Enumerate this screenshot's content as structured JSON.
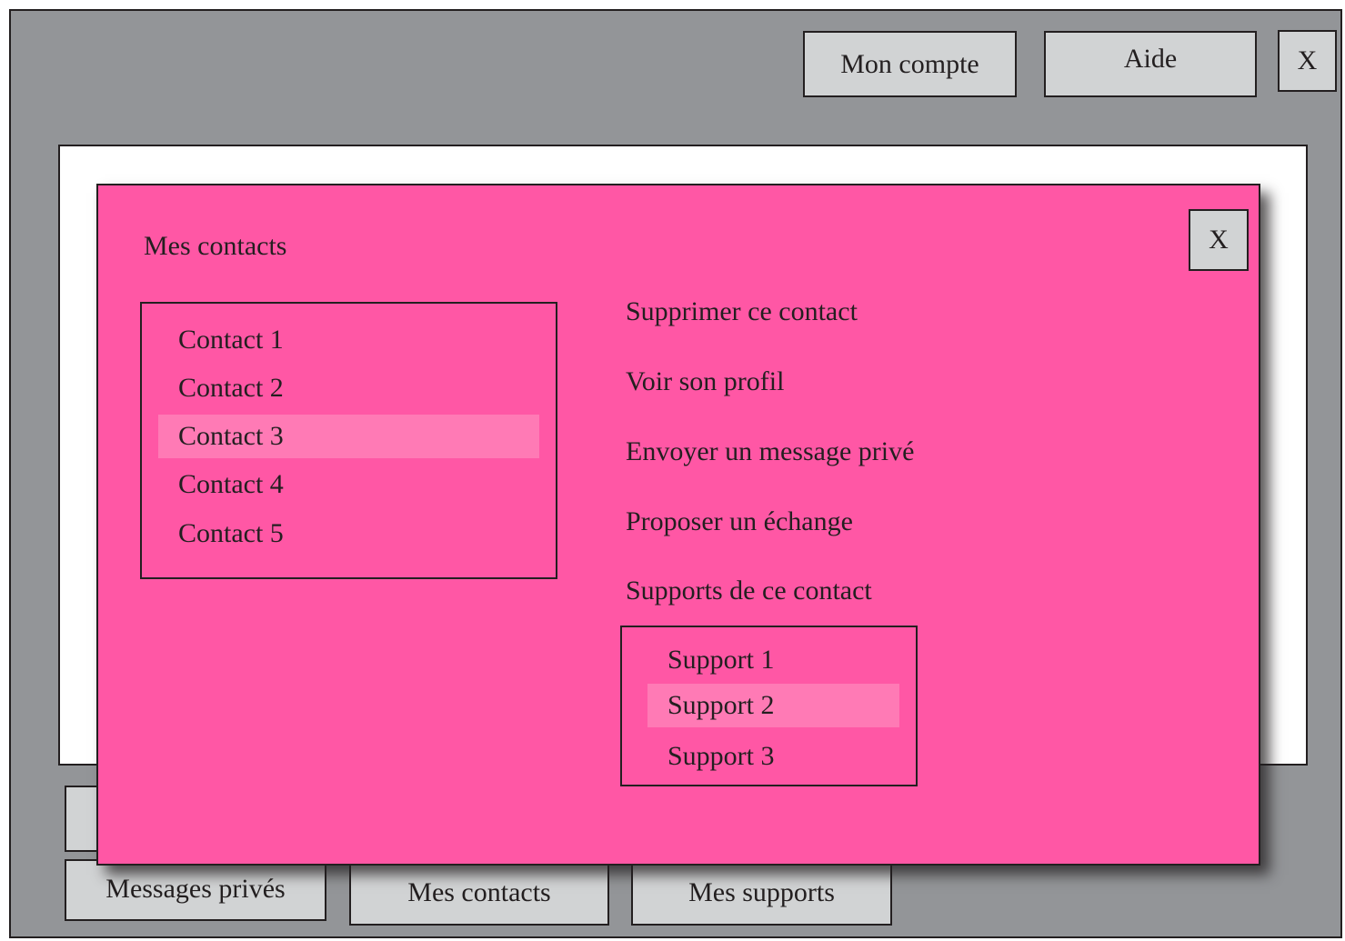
{
  "topbar": {
    "account_label": "Mon compte",
    "help_label": "Aide",
    "close_label": "X"
  },
  "bottom_nav": {
    "hidden_tab_label": "",
    "private_messages_label": "Messages privés",
    "contacts_label": "Mes contacts",
    "supports_label": "Mes supports"
  },
  "modal": {
    "title": "Mes contacts",
    "close_label": "X",
    "contacts": [
      "Contact 1",
      "Contact 2",
      "Contact 3",
      "Contact 4",
      "Contact 5"
    ],
    "selected_contact": "Contact 3",
    "actions": {
      "delete": "Supprimer ce contact",
      "view_profile": "Voir son profil",
      "send_message": "Envoyer un message privé",
      "propose_exchange": "Proposer un échange",
      "supports_heading": "Supports de ce contact"
    },
    "supports": [
      "Support 1",
      "Support 2",
      "Support 3"
    ],
    "selected_support": "Support 2"
  },
  "colors": {
    "background": "#939598",
    "modal": "#ff57a5",
    "selected_row": "#ff7ab5",
    "button": "#d1d3d4",
    "border": "#231f20"
  }
}
